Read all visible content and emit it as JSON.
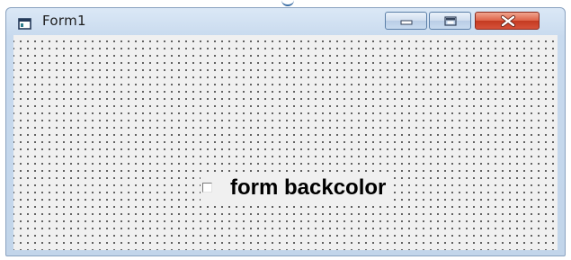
{
  "window": {
    "title": "Form1",
    "icons": {
      "app": "form-window-icon",
      "minimize": "minimize-icon",
      "maximize": "maximize-icon",
      "close": "close-icon"
    }
  },
  "form": {
    "checkbox": {
      "label": "form backcolor",
      "checked": false
    }
  },
  "colors": {
    "form_background": "#f0f0f0",
    "grid_dot": "#2b2b2b",
    "close_button": "#d6523a"
  }
}
